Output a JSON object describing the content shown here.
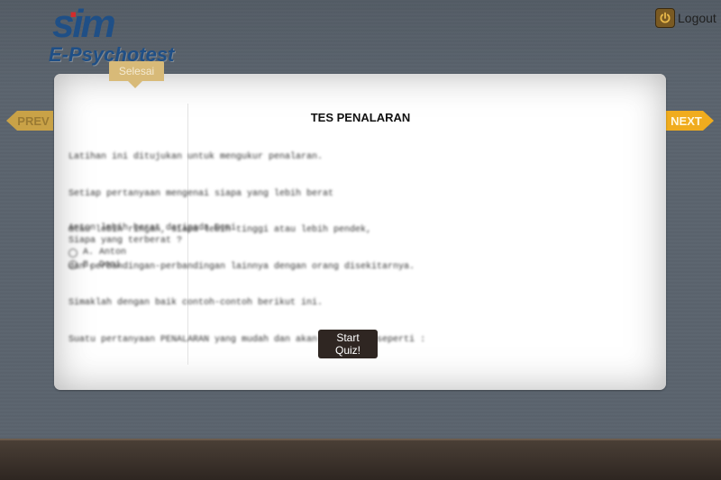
{
  "header": {
    "logo_mark": "sim",
    "logo_text": "E-Psychotest",
    "logout_label": "Logout",
    "logout_icon": "power-icon"
  },
  "nav": {
    "prev_label": "PREV",
    "next_label": "NEXT",
    "tab_label": "Selesai"
  },
  "quiz": {
    "title": "TES PENALARAN",
    "intro_lines": [
      "Latihan ini ditujukan untuk mengukur penalaran.",
      "Setiap pertanyaan mengenai siapa yang lebih berat",
      "atau lebih ringan, siapa lebih tinggi atau lebih pendek,",
      "dan perbandingan-perbandingan lainnya dengan orang disekitarnya.",
      "Simaklah dengan baik contoh-contoh berikut ini.",
      "Suatu pertanyaan PENALARAN yang mudah dan akan berbentuk seperti :"
    ],
    "question_lines": [
      "Anton lebih berat daripada Doni",
      "Siapa yang terberat ?"
    ],
    "options": [
      {
        "key": "A.",
        "label": "Anton"
      },
      {
        "key": "B.",
        "label": "Doni"
      }
    ],
    "start_button": "Start Quiz!"
  },
  "colors": {
    "accent_next": "#f0ac1e",
    "accent_prev": "#c9a247",
    "button_dark": "#2f2622",
    "logo_blue": "#1f4f86"
  }
}
